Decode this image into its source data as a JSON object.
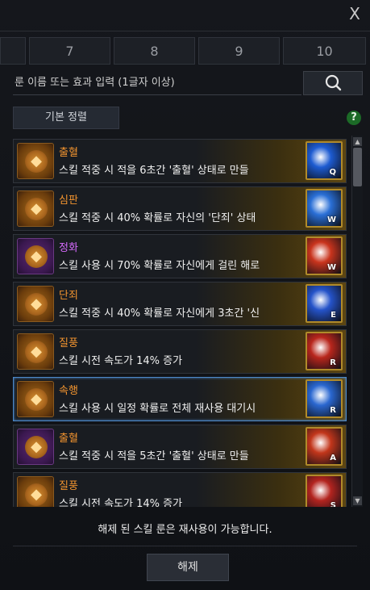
{
  "window": {
    "close_label": "X"
  },
  "tabs": [
    {
      "label": ""
    },
    {
      "label": "7"
    },
    {
      "label": "8"
    },
    {
      "label": "9"
    },
    {
      "label": "10"
    }
  ],
  "search": {
    "placeholder": "룬 이름 또는 효과 입력 (1글자 이상)",
    "value": ""
  },
  "sort": {
    "label": "기본 정렬"
  },
  "help": {
    "label": "?"
  },
  "runes": [
    {
      "name": "출혈",
      "desc": "스킬 적중 시 적을 6초간 '출혈' 상태로 만들",
      "icon_color": "gold",
      "skill_key": "Q",
      "skill_color": "#1d5bd1"
    },
    {
      "name": "심판",
      "desc": "스킬 적중 시 40% 확률로 자신의 '단죄' 상태",
      "icon_color": "gold",
      "skill_key": "W",
      "skill_color": "#2a6fd6"
    },
    {
      "name": "정화",
      "desc": "스킬 사용 시 70% 확률로 자신에게 걸린 해로",
      "icon_color": "purple",
      "skill_key": "W",
      "skill_color": "#c9341d"
    },
    {
      "name": "단죄",
      "desc": "스킬 적중 시 40% 확률로 자신에게 3초간 '신",
      "icon_color": "gold",
      "skill_key": "E",
      "skill_color": "#2553c9"
    },
    {
      "name": "질풍",
      "desc": "스킬 시전 속도가 14% 증가",
      "icon_color": "gold",
      "skill_key": "R",
      "skill_color": "#b8261c"
    },
    {
      "name": "속행",
      "desc": "스킬 사용 시 일정 확률로 전체 재사용 대기시",
      "icon_color": "gold",
      "skill_key": "R",
      "skill_color": "#2a67d0",
      "selected": true
    },
    {
      "name": "출혈",
      "desc": "스킬 적중 시 적을 5초간 '출혈' 상태로 만들",
      "icon_color": "purple",
      "skill_key": "A",
      "skill_color": "#c2361b"
    },
    {
      "name": "질풍",
      "desc": "스킬 시전 속도가 14% 증가",
      "icon_color": "gold",
      "skill_key": "S",
      "skill_color": "#b3241f"
    }
  ],
  "notice": "해제 된 스킬 룬은 재사용이 가능합니다.",
  "release_button": "해제",
  "colors": {
    "accent_orange": "#f2942f",
    "accent_purple": "#d86bff",
    "selection_blue": "#4c88c9"
  }
}
